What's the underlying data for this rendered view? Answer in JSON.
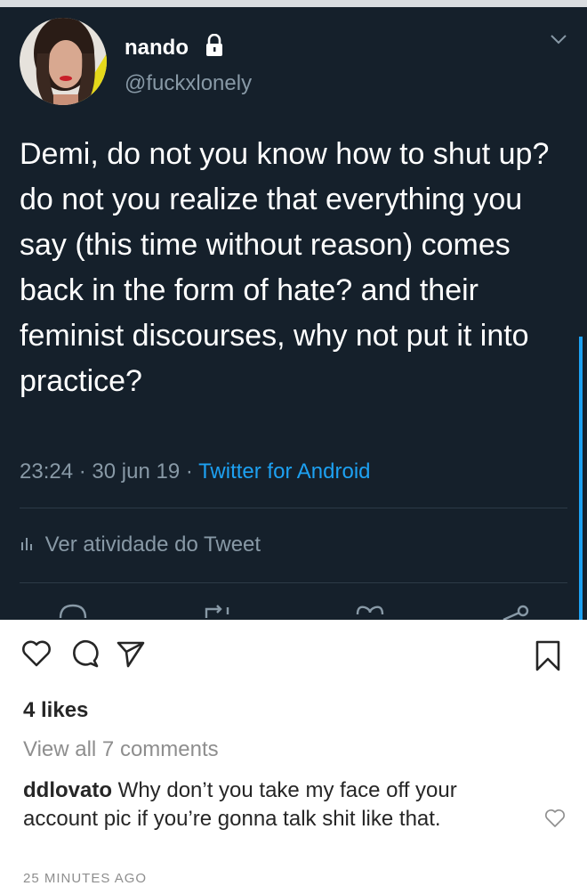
{
  "tweet": {
    "display_name": "nando",
    "handle": "@fuckxlonely",
    "text": "Demi, do not you know how to shut up?  do not you realize that everything you say (this time without reason) comes back in the form of hate? and their feminist discourses, why not put it into practice?",
    "time": "23:24",
    "date": "30 jun 19",
    "source": "Twitter for Android",
    "activity_label": "Ver atividade do Tweet",
    "icons": [
      "lock-icon",
      "chevron-down-icon",
      "analytics-icon",
      "reply-icon",
      "retweet-icon",
      "like-icon",
      "share-icon"
    ]
  },
  "instagram": {
    "likes": "4 likes",
    "view_all": "View all 7 comments",
    "comment_user": "ddlovato",
    "comment_text": "Why don’t you take my face off your account pic if you’re gonna talk shit like that.",
    "time_ago": "25 MINUTES AGO",
    "icons": [
      "heart-icon",
      "comment-icon",
      "send-icon",
      "bookmark-icon"
    ]
  },
  "colors": {
    "tweet_background": "#15202b",
    "tweet_link": "#1da1f2",
    "tweet_secondary": "#8899a6"
  }
}
